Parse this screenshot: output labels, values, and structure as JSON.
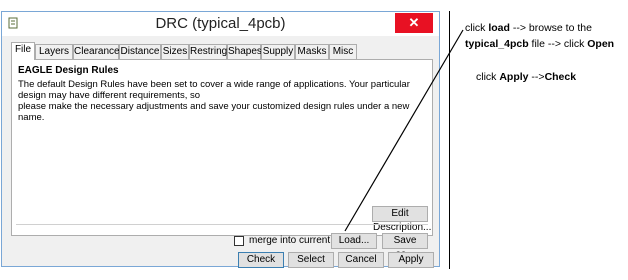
{
  "window": {
    "title": "DRC (typical_4pcb)",
    "close_symbol": "✕"
  },
  "tabs": [
    {
      "label": "File",
      "active": true
    },
    {
      "label": "Layers"
    },
    {
      "label": "Clearance"
    },
    {
      "label": "Distance"
    },
    {
      "label": "Sizes"
    },
    {
      "label": "Restring"
    },
    {
      "label": "Shapes"
    },
    {
      "label": "Supply"
    },
    {
      "label": "Masks"
    },
    {
      "label": "Misc"
    }
  ],
  "panel": {
    "heading": "EAGLE Design Rules",
    "description_line1": "The default Design Rules have been set to cover a wide range of applications. Your particular design may have different requirements, so",
    "description_line2": "please make the necessary adjustments and save your customized design rules under a new name.",
    "edit_description_label": "Edit Description...",
    "merge_label": "merge into current settings",
    "load_label": "Load...",
    "save_as_label": "Save as..."
  },
  "buttons": {
    "check": "Check",
    "select": "Select",
    "cancel": "Cancel",
    "apply": "Apply"
  },
  "annotation": {
    "line1_prefix": "click ",
    "line1_bold": "load",
    "line1_suffix": " --> browse to the",
    "line2_bold1": "typical_4pcb",
    "line2_mid": " file --> click ",
    "line2_bold2": "Open",
    "line3_prefix": "click ",
    "line3_bold1": "Apply",
    "line3_mid": "  -->",
    "line3_bold2": "Check"
  },
  "icons": {
    "app": "document-icon",
    "close": "close-icon"
  }
}
